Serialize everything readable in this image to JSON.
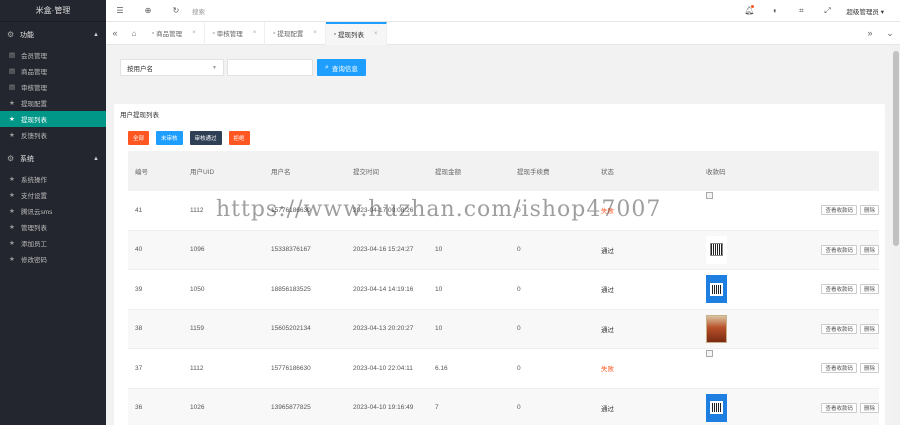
{
  "app": {
    "brand": "米盒·管理"
  },
  "sidebar": {
    "groups": [
      {
        "label": "功能",
        "items": [
          "会员管理",
          "商品管理",
          "审核管理",
          "提现配置",
          "提现列表",
          "反馈列表"
        ]
      },
      {
        "label": "系统",
        "items": [
          "系统操作",
          "支付设置",
          "腾讯云sms",
          "管理列表",
          "添加员工",
          "修改密码"
        ]
      }
    ],
    "active_item": "提现列表"
  },
  "topbar": {
    "search_placeholder": "搜索",
    "admin_label": "超级管理员"
  },
  "tabs": [
    "商品管理",
    "审核管理",
    "提现配置",
    "提现列表"
  ],
  "active_tab": "提现列表",
  "filter": {
    "select_value": "按用户名",
    "input_value": "",
    "query_button": "查询信息"
  },
  "card": {
    "title": "用户提现列表",
    "buttons": {
      "all": "全部",
      "pending": "未审核",
      "passed": "审核通过",
      "rejected": "拒绝"
    }
  },
  "table": {
    "headers": [
      "编号",
      "用户UID",
      "用户名",
      "提交时间",
      "提现金额",
      "提现手续费",
      "状态",
      "收款码",
      ""
    ],
    "actions": {
      "view": "查看收款码",
      "delete": "删除"
    },
    "rows": [
      {
        "id": "41",
        "uid": "1112",
        "username": "15776186630",
        "time": "2023-04-17 00:08:26",
        "amount": "",
        "fee": "0",
        "status": "失败",
        "qr": "broken"
      },
      {
        "id": "40",
        "uid": "1096",
        "username": "15338376167",
        "time": "2023-04-16 15:24:27",
        "amount": "10",
        "fee": "0",
        "status": "通过",
        "qr": "qr"
      },
      {
        "id": "39",
        "uid": "1050",
        "username": "18856183525",
        "time": "2023-04-14 14:19:16",
        "amount": "10",
        "fee": "0",
        "status": "通过",
        "qr": "blue"
      },
      {
        "id": "38",
        "uid": "1159",
        "username": "15605202134",
        "time": "2023-04-13 20:20:27",
        "amount": "10",
        "fee": "0",
        "status": "通过",
        "qr": "photo"
      },
      {
        "id": "37",
        "uid": "1112",
        "username": "15776186630",
        "time": "2023-04-10 22:04:11",
        "amount": "6.16",
        "fee": "0",
        "status": "失败",
        "qr": "broken"
      },
      {
        "id": "36",
        "uid": "1026",
        "username": "13965877825",
        "time": "2023-04-10 19:16:49",
        "amount": "7",
        "fee": "0",
        "status": "通过",
        "qr": "blue"
      }
    ]
  },
  "watermark": "https://www.huzhan.com/ishop47007"
}
